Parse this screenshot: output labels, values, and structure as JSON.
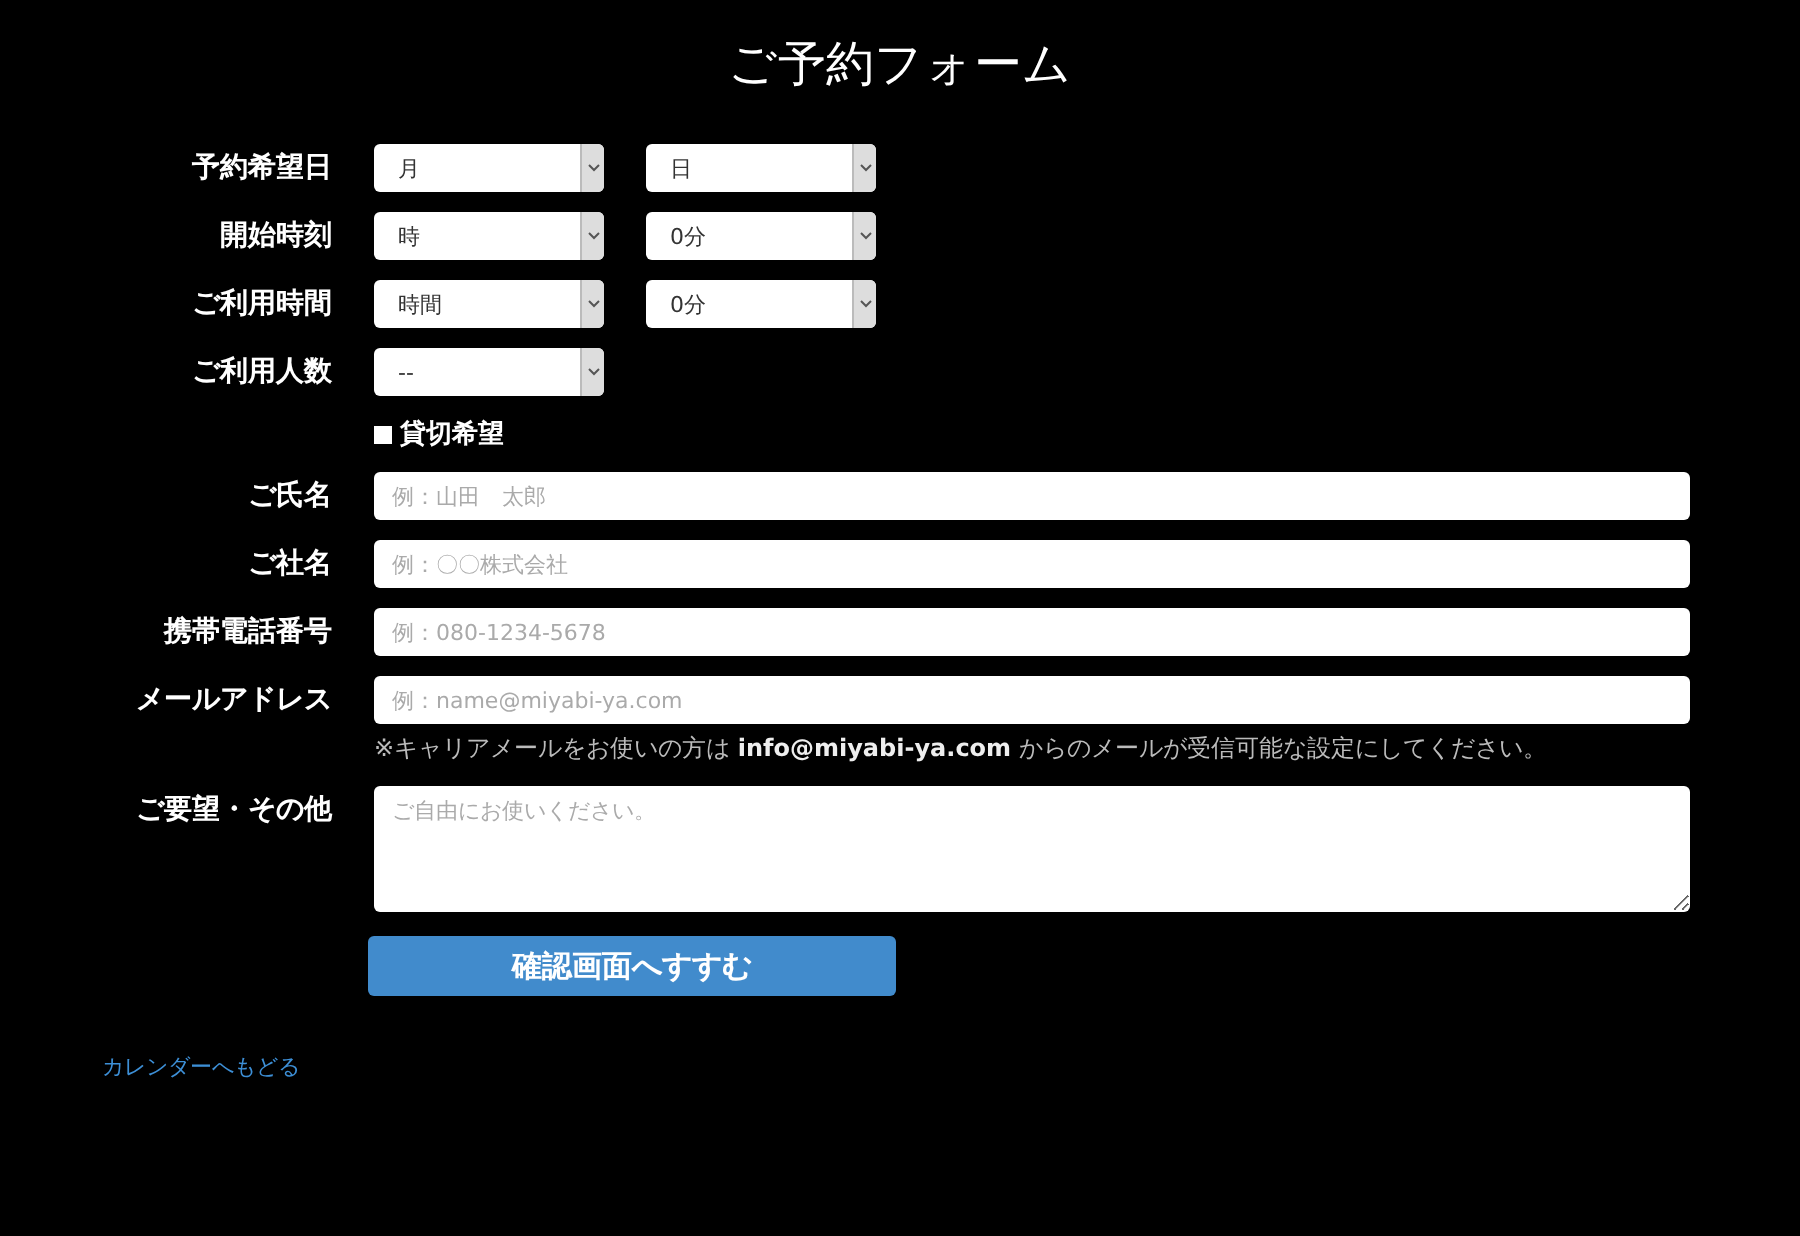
{
  "title": "ご予約フォーム",
  "rows": [
    {
      "kind": "selects",
      "label": "予約希望日",
      "selects": [
        {
          "value": "月"
        },
        {
          "value": "日"
        }
      ]
    },
    {
      "kind": "selects",
      "label": "開始時刻",
      "selects": [
        {
          "value": "時"
        },
        {
          "value": "0分"
        }
      ]
    },
    {
      "kind": "selects",
      "label": "ご利用時間",
      "selects": [
        {
          "value": "時間"
        },
        {
          "value": "0分"
        }
      ]
    },
    {
      "kind": "selects",
      "label": "ご利用人数",
      "selects": [
        {
          "value": "--"
        }
      ]
    },
    {
      "kind": "checkbox",
      "label": "貸切希望",
      "checked": false
    },
    {
      "kind": "text",
      "label": "ご氏名",
      "placeholder": "例：山田　太郎"
    },
    {
      "kind": "text",
      "label": "ご社名",
      "placeholder": "例：〇〇株式会社"
    },
    {
      "kind": "text",
      "label": "携帯電話番号",
      "placeholder": "例：080-1234-5678"
    },
    {
      "kind": "text",
      "label": "メールアドレス",
      "placeholder": "例：name@miyabi-ya.com",
      "note": "※キャリアメールをお使いの方は **info@miyabi-ya.com** からのメールが受信可能な設定にしてください。"
    },
    {
      "kind": "textarea",
      "label": "ご要望・その他",
      "placeholder": "ご自由にお使いください。"
    }
  ],
  "submit": "確認画面へすすむ",
  "back_link": "カレンダーへもどる"
}
